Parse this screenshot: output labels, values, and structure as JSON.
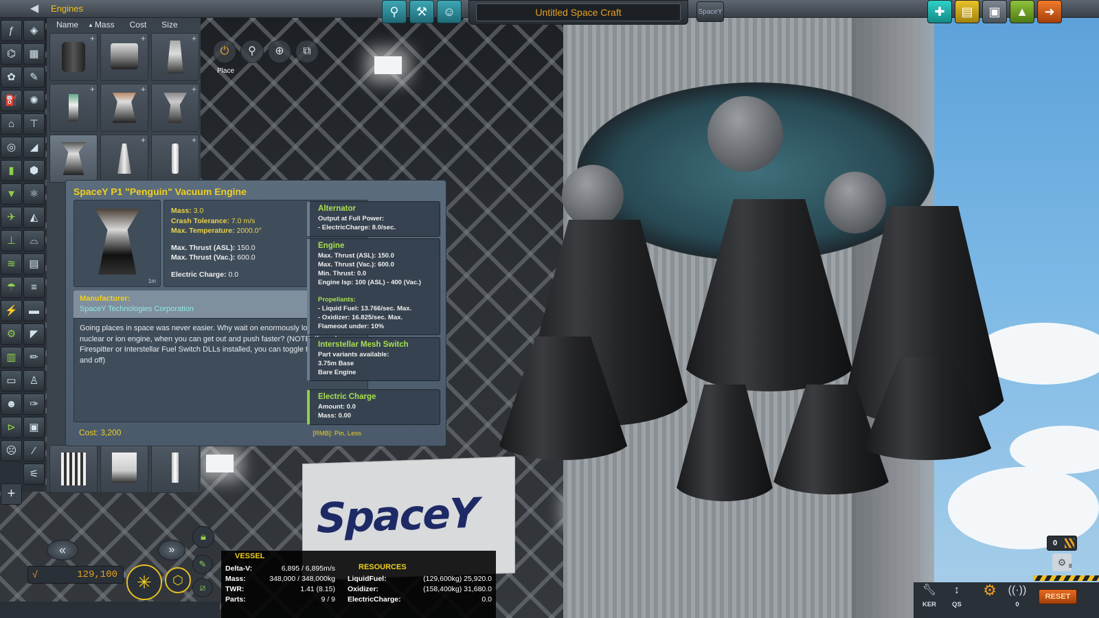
{
  "topbar": {
    "category_title": "Engines",
    "craft_name": "Untitled Space Craft",
    "flag_label": "SpaceY"
  },
  "parts_panel": {
    "sort_columns": [
      "Name",
      "Mass",
      "Cost",
      "Size"
    ],
    "sort_active_indicator": "▲"
  },
  "tools": {
    "place_label": "Place"
  },
  "tooltip": {
    "title": "SpaceY P1 \"Penguin\" Vacuum Engine",
    "thumb_scale": "1m",
    "stats": {
      "mass_label": "Mass:",
      "mass_value": "3.0",
      "crash_label": "Crash Tolerance:",
      "crash_value": "7.0 m/s",
      "temp_label": "Max. Temperature:",
      "temp_value": "2000.0°",
      "thrust_asl_label": "Max. Thrust (ASL):",
      "thrust_asl_value": "150.0",
      "thrust_vac_label": "Max. Thrust (Vac.):",
      "thrust_vac_value": "600.0",
      "ec_label": "Electric Charge:",
      "ec_value": "0.0"
    },
    "manufacturer_label": "Manufacturer:",
    "manufacturer_name": "SpaceY Technologies Corporation",
    "description": "Going places in space was never easier. Why wait on enormously long burns with a nuclear or ion engine, when you can get out and push faster? (NOTE: If you have Firespitter or Interstellar Fuel Switch DLLs installed, you can toggle the tank-cap on and off)",
    "cost": "Cost: 3,200",
    "rmb_hint": "[RMB]: Pin, Less",
    "modules": {
      "alternator": {
        "title": "Alternator",
        "line1": "Output at Full Power:",
        "line2": "- ElectricCharge: 8.0/sec."
      },
      "engine": {
        "title": "Engine",
        "line1": "Max. Thrust (ASL): 150.0",
        "line2": "Max. Thrust (Vac.): 600.0",
        "line3": "Min. Thrust: 0.0",
        "line4": "Engine Isp: 100 (ASL) - 400 (Vac.)",
        "propellants_label": "Propellants:",
        "line5": "- Liquid Fuel: 13.766/sec. Max.",
        "line6": "- Oxidizer: 16.825/sec. Max.",
        "line7": "Flameout under: 10%"
      },
      "mesh_switch": {
        "title": "Interstellar Mesh Switch",
        "line1": "Part variants available:",
        "line2": "3.75m Base",
        "line3": "Bare Engine"
      },
      "electric_charge": {
        "title": "Electric Charge",
        "line1": "Amount: 0.0",
        "line2": "Mass: 0.00"
      }
    }
  },
  "funds": "129,100",
  "vessel": {
    "title": "VESSEL",
    "deltav_label": "Delta-V:",
    "deltav_value": "6,895 / 6,895m/s",
    "mass_label": "Mass:",
    "mass_value": "348,000 / 348,000kg",
    "twr_label": "TWR:",
    "twr_value": "1.41 (8.15)",
    "parts_label": "Parts:",
    "parts_value": "9 / 9"
  },
  "resources": {
    "title": "RESOURCES",
    "lf_label": "LiquidFuel:",
    "lf_value": "(129,600kg) 25,920.0",
    "ox_label": "Oxidizer:",
    "ox_value": "(158,400kg) 31,680.0",
    "ec_label": "ElectricCharge:",
    "ec_value": "0.0"
  },
  "bottom_right": {
    "counter": "0",
    "gear_badge": "8",
    "ker_label": "KER",
    "qs_label": "QS",
    "signal_count": "0",
    "reset_label": "RESET"
  },
  "scene": {
    "banner_text": "SpaceY"
  },
  "colors": {
    "accent_yellow": "#f0d020",
    "accent_green": "#a8e050",
    "accent_teal": "#3fa7b4",
    "funds_orange": "#e8a020"
  }
}
